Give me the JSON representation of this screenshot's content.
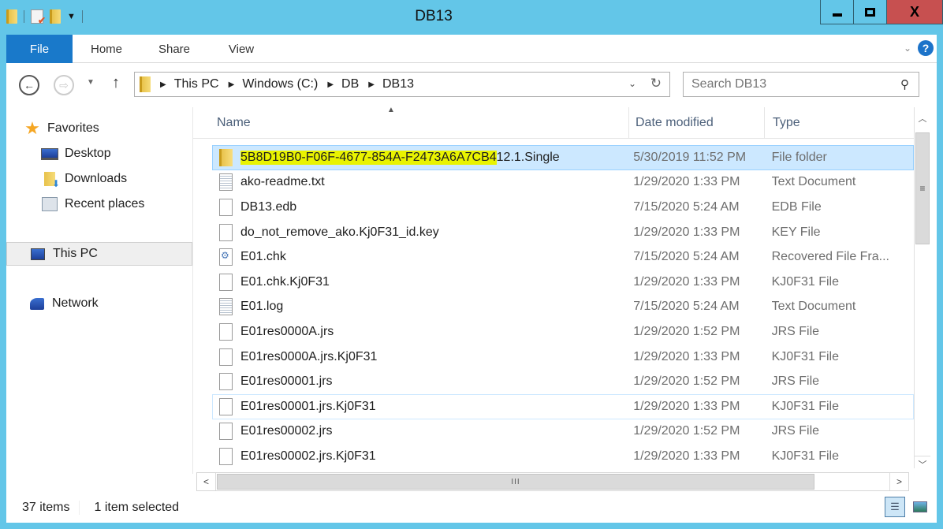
{
  "window": {
    "title": "DB13",
    "controls": {
      "minimize": "minimize",
      "maximize": "maximize",
      "close": "X"
    }
  },
  "ribbon": {
    "tabs": [
      {
        "label": "File",
        "active": true
      },
      {
        "label": "Home"
      },
      {
        "label": "Share"
      },
      {
        "label": "View"
      }
    ],
    "help": "?"
  },
  "navigation": {
    "breadcrumb": [
      "This PC",
      "Windows (C:)",
      "DB",
      "DB13"
    ],
    "search_placeholder": "Search DB13"
  },
  "sidebar": {
    "items": [
      {
        "label": "Favorites",
        "icon": "star-icon"
      },
      {
        "label": "Desktop",
        "icon": "desktop-icon"
      },
      {
        "label": "Downloads",
        "icon": "downloads-icon"
      },
      {
        "label": "Recent places",
        "icon": "recent-places-icon"
      },
      {
        "label": "This PC",
        "icon": "this-pc-icon",
        "selected": true
      },
      {
        "label": "Network",
        "icon": "network-icon"
      }
    ]
  },
  "filelist": {
    "columns": {
      "name": "Name",
      "date": "Date modified",
      "type": "Type"
    },
    "sort": "ascending",
    "rows": [
      {
        "name_highlighted": "5B8D19B0-F06F-4677-854A-F2473A6A7CB4",
        "name_rest": "12.1.Single",
        "date": "5/30/2019 11:52 PM",
        "type": "File folder",
        "icon": "folder",
        "selected": true
      },
      {
        "name": "ako-readme.txt",
        "date": "1/29/2020 1:33 PM",
        "type": "Text Document",
        "icon": "text"
      },
      {
        "name": "DB13.edb",
        "date": "7/15/2020 5:24 AM",
        "type": "EDB File",
        "icon": "file"
      },
      {
        "name": "do_not_remove_ako.Kj0F31_id.key",
        "date": "1/29/2020 1:33 PM",
        "type": "KEY File",
        "icon": "file"
      },
      {
        "name": "E01.chk",
        "date": "7/15/2020 5:24 AM",
        "type": "Recovered File Fra...",
        "icon": "chk"
      },
      {
        "name": "E01.chk.Kj0F31",
        "date": "1/29/2020 1:33 PM",
        "type": "KJ0F31 File",
        "icon": "file"
      },
      {
        "name": "E01.log",
        "date": "7/15/2020 5:24 AM",
        "type": "Text Document",
        "icon": "text"
      },
      {
        "name": "E01res0000A.jrs",
        "date": "1/29/2020 1:52 PM",
        "type": "JRS File",
        "icon": "file"
      },
      {
        "name": "E01res0000A.jrs.Kj0F31",
        "date": "1/29/2020 1:33 PM",
        "type": "KJ0F31 File",
        "icon": "file"
      },
      {
        "name": "E01res00001.jrs",
        "date": "1/29/2020 1:52 PM",
        "type": "JRS File",
        "icon": "file"
      },
      {
        "name": "E01res00001.jrs.Kj0F31",
        "date": "1/29/2020 1:33 PM",
        "type": "KJ0F31 File",
        "icon": "file",
        "focused": true
      },
      {
        "name": "E01res00002.jrs",
        "date": "1/29/2020 1:52 PM",
        "type": "JRS File",
        "icon": "file"
      },
      {
        "name": "E01res00002.jrs.Kj0F31",
        "date": "1/29/2020 1:33 PM",
        "type": "KJ0F31 File",
        "icon": "file"
      }
    ]
  },
  "statusbar": {
    "item_count": "37 items",
    "selection": "1 item selected"
  },
  "colors": {
    "accent": "#1979ca",
    "selection": "#cce8ff",
    "highlight": "#e9f300",
    "close_button": "#c75050",
    "window_border": "#63c6e8"
  }
}
